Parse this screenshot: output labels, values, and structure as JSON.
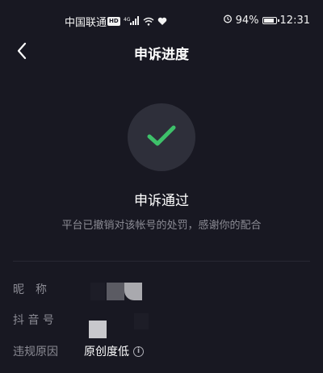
{
  "status_bar": {
    "carrier": "中国联通",
    "network_badge": "HD",
    "signal_type": "4G",
    "battery_percent": "94%",
    "battery_level": 0.94,
    "time": "12:31",
    "icons": [
      "hd-icon",
      "signal-icon",
      "wifi-icon",
      "heart-icon",
      "alarm-icon",
      "battery-icon"
    ]
  },
  "header": {
    "title": "申诉进度",
    "back_icon": "chevron-left-icon"
  },
  "result": {
    "icon": "checkmark-icon",
    "icon_color": "#3ec16a",
    "title": "申诉通过",
    "description": "平台已撤销对该帐号的处罚，感谢你的配合"
  },
  "details": {
    "nickname_label": "昵　称",
    "douyin_id_label": "抖 音 号",
    "violation_label": "违规原因",
    "violation_value": "原创度低",
    "info_icon": "info-icon"
  },
  "colors": {
    "background": "#181822",
    "circle": "#2e2f3a",
    "secondary_text": "#8b8b94",
    "accent_green": "#3ec16a"
  }
}
